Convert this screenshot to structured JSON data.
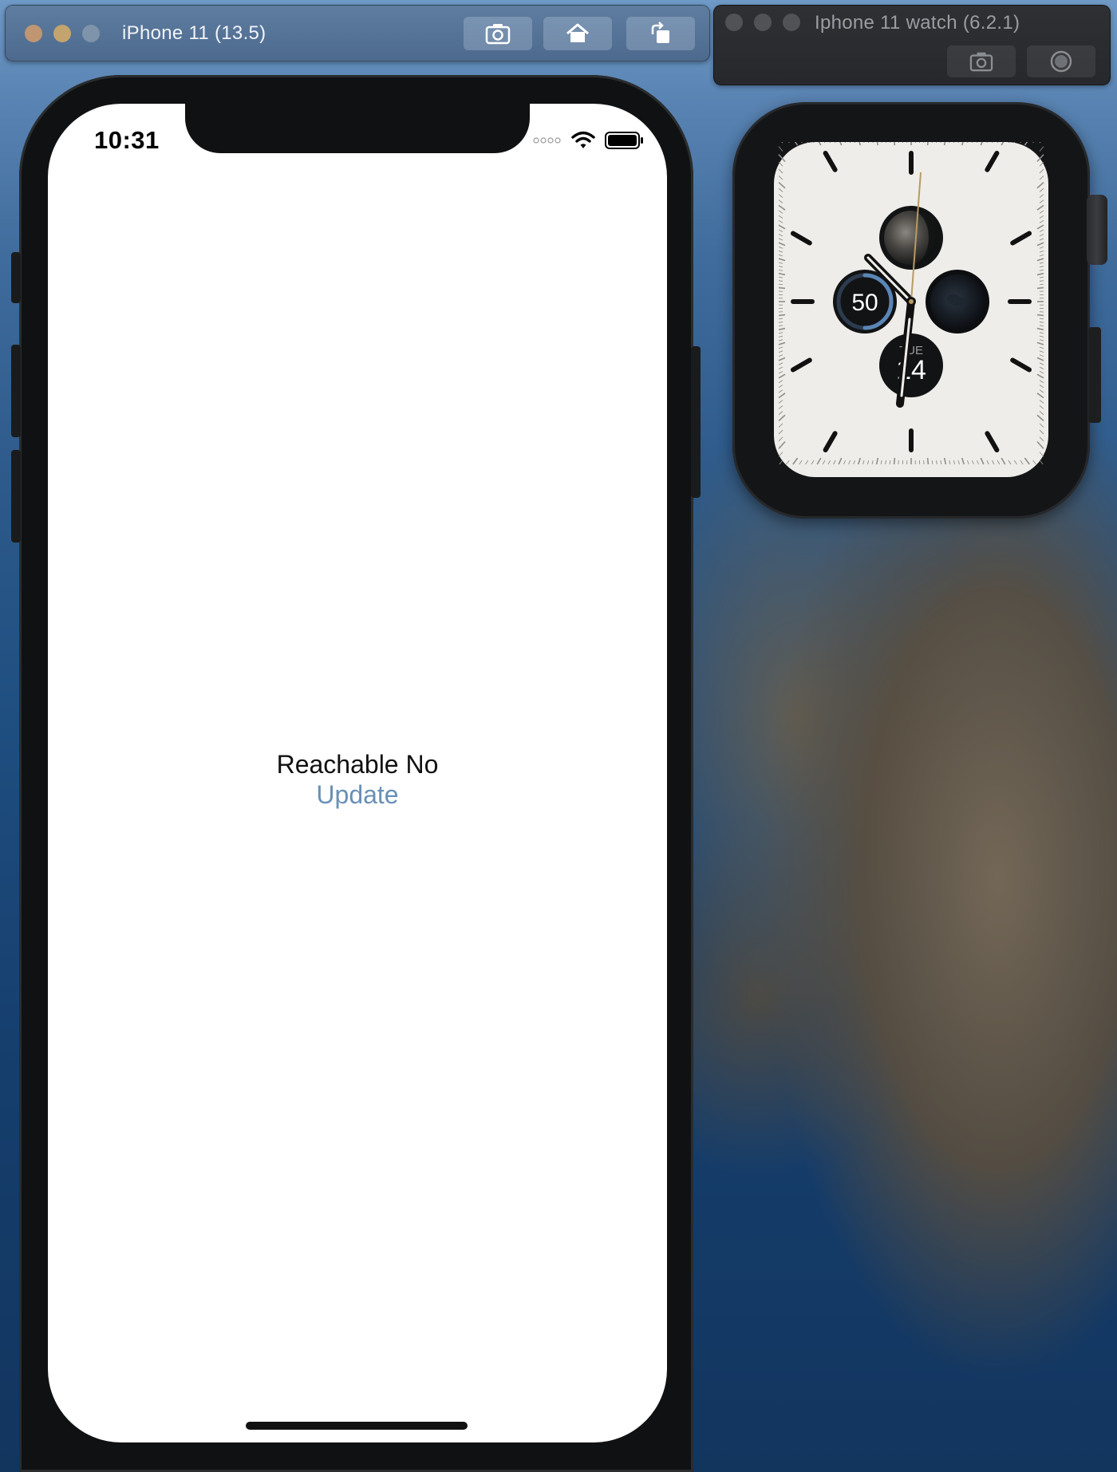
{
  "iphone_window": {
    "title": "iPhone 11 (13.5)",
    "buttons": [
      "screenshot",
      "home",
      "rotate"
    ]
  },
  "watch_window": {
    "title": "Iphone 11 watch (6.2.1)",
    "buttons": [
      "screenshot",
      "digital-crown"
    ]
  },
  "phone_status": {
    "time": "10:31"
  },
  "app": {
    "reachable_label": "Reachable No",
    "update_label": "Update",
    "update_color": "#6990b6"
  },
  "watch_face": {
    "activity_value": "50",
    "day": "TUE",
    "date": "14"
  }
}
